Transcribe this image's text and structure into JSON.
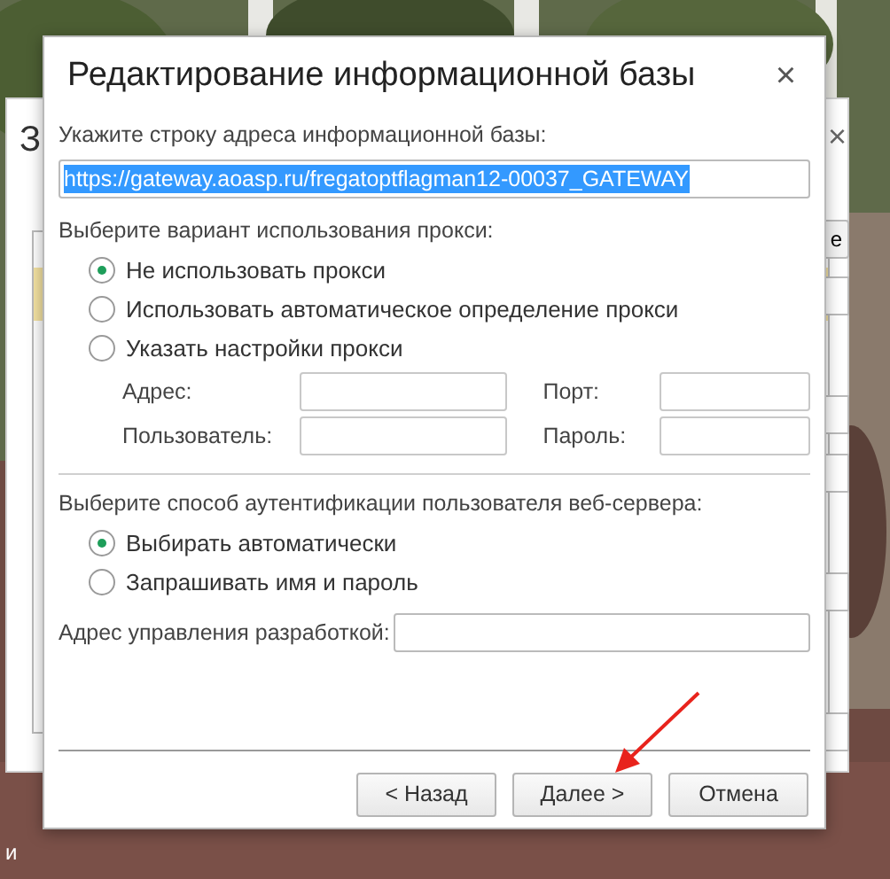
{
  "background_window": {
    "title": "З",
    "close": "×",
    "button": "е"
  },
  "desktop_label": "и",
  "dialog": {
    "title": "Редактирование информационной базы",
    "close": "×",
    "address_label": "Укажите строку адреса информационной базы:",
    "address_value": "https://gateway.aoasp.ru/fregatoptflagman12-00037_GATEWAY",
    "proxy_label": "Выберите вариант использования прокси:",
    "proxy_options": [
      {
        "label": "Не использовать прокси",
        "selected": true
      },
      {
        "label": "Использовать автоматическое определение прокси",
        "selected": false
      },
      {
        "label": "Указать настройки прокси",
        "selected": false
      }
    ],
    "proxy_fields": [
      {
        "label": "Адрес:"
      },
      {
        "label": "Порт:"
      },
      {
        "label": "Пользователь:"
      },
      {
        "label": "Пароль:"
      }
    ],
    "auth_label": "Выберите способ аутентификации пользователя веб-сервера:",
    "auth_options": [
      {
        "label": "Выбирать автоматически",
        "selected": true
      },
      {
        "label": "Запрашивать имя и пароль",
        "selected": false
      }
    ],
    "dev_label": "Адрес управления разработкой:",
    "buttons": [
      "< Назад",
      "Далее >",
      "Отмена"
    ]
  }
}
